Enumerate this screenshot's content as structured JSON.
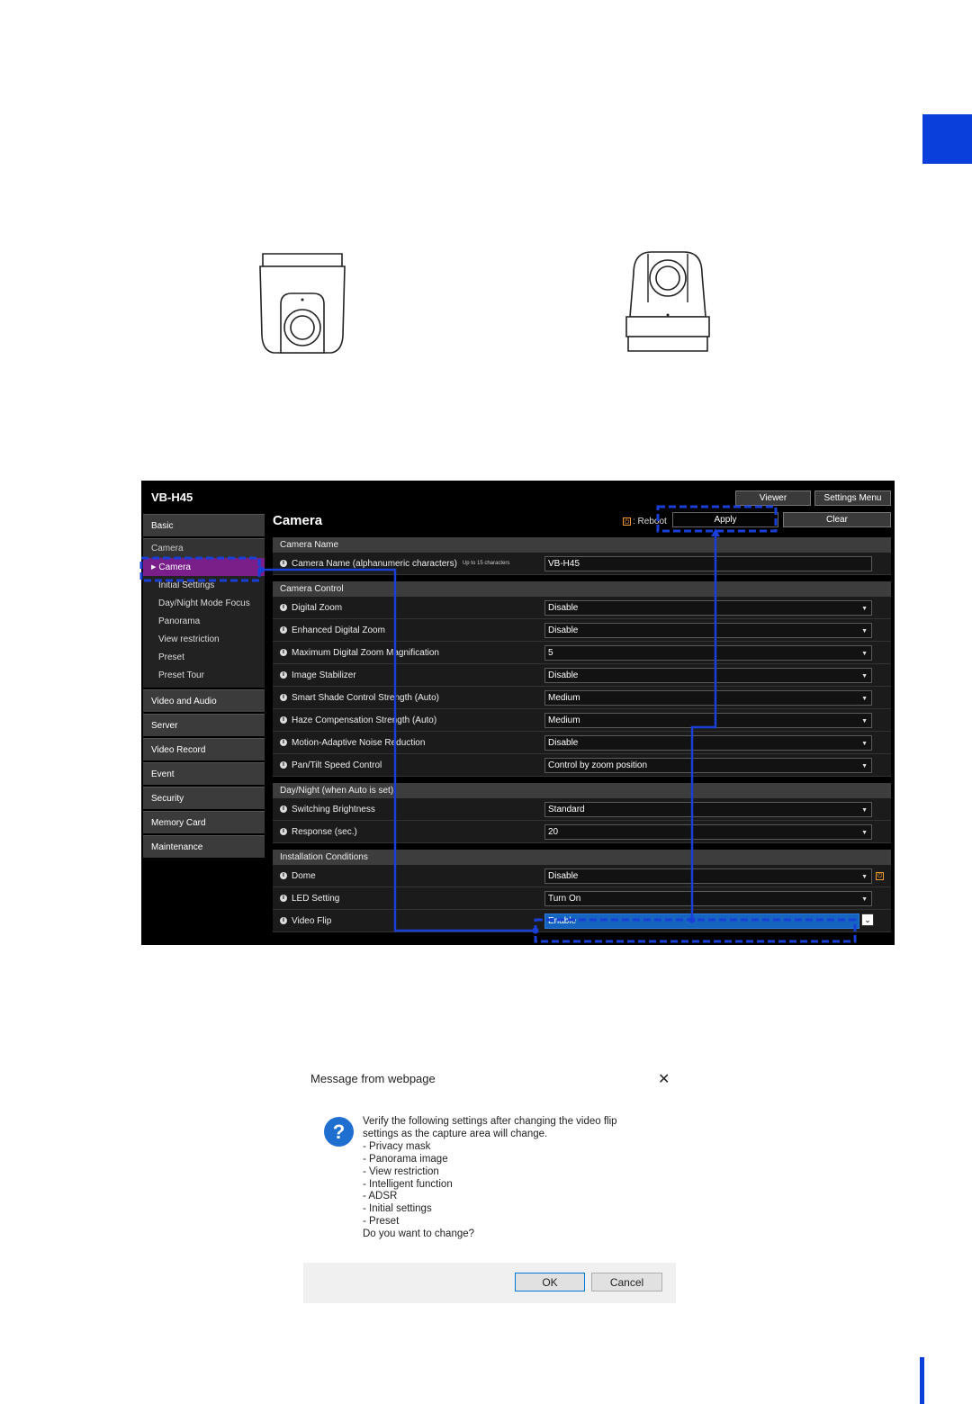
{
  "ui": {
    "brand": "VB-H45",
    "top_buttons": {
      "viewer": "Viewer",
      "settings_menu": "Settings Menu"
    },
    "page_title": "Camera",
    "reboot_label": ": Reboot",
    "apply": "Apply",
    "clear": "Clear",
    "sidebar": {
      "basic": "Basic",
      "camera_group": "Camera",
      "sub": [
        "Camera",
        "Initial Settings",
        "Day/Night Mode Focus",
        "Panorama",
        "View restriction",
        "Preset",
        "Preset Tour"
      ],
      "items": [
        "Video and Audio",
        "Server",
        "Video Record",
        "Event",
        "Security",
        "Memory Card",
        "Maintenance"
      ]
    },
    "sections": {
      "camera_name": {
        "title": "Camera Name",
        "label": "Camera Name (alphanumeric characters)",
        "note": "Up to 15 characters",
        "value": "VB-H45"
      },
      "camera_control": {
        "title": "Camera Control",
        "rows": [
          {
            "label": "Digital Zoom",
            "value": "Disable"
          },
          {
            "label": "Enhanced Digital Zoom",
            "value": "Disable"
          },
          {
            "label": "Maximum Digital Zoom Magnification",
            "value": "5"
          },
          {
            "label": "Image Stabilizer",
            "value": "Disable"
          },
          {
            "label": "Smart Shade Control Strength (Auto)",
            "value": "Medium"
          },
          {
            "label": "Haze Compensation Strength (Auto)",
            "value": "Medium"
          },
          {
            "label": "Motion-Adaptive Noise Reduction",
            "value": "Disable"
          },
          {
            "label": "Pan/Tilt Speed Control",
            "value": "Control by zoom position"
          }
        ]
      },
      "day_night": {
        "title": "Day/Night (when Auto is set)",
        "rows": [
          {
            "label": "Switching Brightness",
            "value": "Standard"
          },
          {
            "label": "Response (sec.)",
            "value": "20"
          }
        ]
      },
      "installation": {
        "title": "Installation Conditions",
        "rows": [
          {
            "label": "Dome",
            "value": "Disable"
          },
          {
            "label": "LED Setting",
            "value": "Turn On"
          },
          {
            "label": "Video Flip",
            "value": "Enable"
          }
        ]
      }
    }
  },
  "dialog": {
    "title": "Message from webpage",
    "close": "✕",
    "icon": "?",
    "lines": [
      "Verify the following settings after changing the video flip",
      "settings as the capture area will change.",
      "- Privacy mask",
      "- Panorama image",
      "- View restriction",
      "- Intelligent function",
      "- ADSR",
      "- Initial settings",
      "- Preset",
      "Do you want to change?"
    ],
    "ok": "OK",
    "cancel": "Cancel"
  },
  "colors": {
    "accent": "#0a3fdb",
    "highlight_blue": "#1565c0",
    "active_nav": "#7a1e8a"
  }
}
